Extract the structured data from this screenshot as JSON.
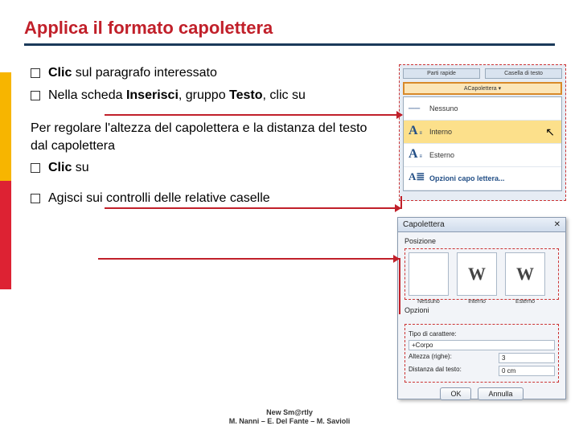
{
  "title": "Applica il formato capolettera",
  "bullets": {
    "b1_pre": "Clic",
    "b1_rest": " sul paragrafo interessato",
    "b2_a": "Nella scheda ",
    "b2_b": "Inserisci",
    "b2_c": ", gruppo ",
    "b2_d": "Testo",
    "b2_e": ", clic su",
    "para": "Per regolare l'altezza del capolettera e la distanza del testo dal capolettera",
    "b3_pre": "Clic",
    "b3_rest": " su",
    "b4": "Agisci sui controlli delle relative caselle"
  },
  "ribbon": {
    "top1": "Parti rapide",
    "top2": "Casella di testo",
    "top3": "Capolettera",
    "items": [
      "Nessuno",
      "Interno",
      "Esterno",
      "Opzioni capo lettera..."
    ]
  },
  "dialog": {
    "title": "Capolettera",
    "section1": "Posizione",
    "thumbs": [
      "Nessuno",
      "Interno",
      "Esterno"
    ],
    "section2": "Opzioni",
    "f1_label": "Tipo di carattere:",
    "f1_val": "+Corpo",
    "f2_label": "Altezza (righe):",
    "f2_val": "3",
    "f3_label": "Distanza dal testo:",
    "f3_val": "0 cm",
    "ok": "OK",
    "cancel": "Annulla"
  },
  "footer": {
    "l1": "New Sm@rtly",
    "l2": "M. Nanni – E. Del Fante – M. Savioli"
  }
}
